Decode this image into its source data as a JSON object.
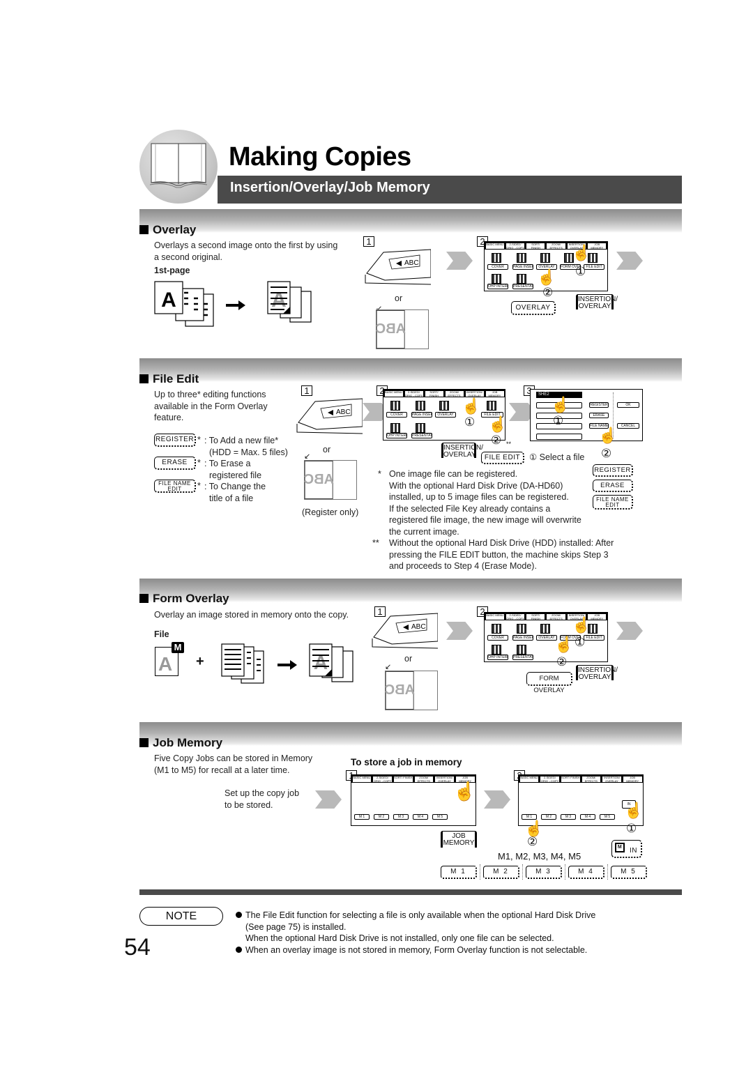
{
  "header": {
    "title": "Making Copies",
    "subtitle": "Insertion/Overlay/Job Memory",
    "icon": "book-icon"
  },
  "common": {
    "or": "or",
    "step_labels": [
      "1",
      "2",
      "3"
    ],
    "circled_1": "①",
    "circled_2": "②",
    "tabs": [
      "BASIC MENU",
      "2-SIDED/ ORIG→COPY",
      "SORT/ FINISH",
      "ZOOM/ EFFECTS",
      "INSERTION/ OVERLAY",
      "JOB MEMORY"
    ],
    "panel_buttons": [
      "COVER",
      "PAGE INSERTION",
      "OVERLAY",
      "FORM OVERLAY",
      "FILE EDIT",
      "OHP INTERLEAVING",
      "PRESENTATION"
    ],
    "glass_text": "ABC",
    "feeder_text": "ABC",
    "insertion_overlay_key": "INSERTION/ OVERLAY"
  },
  "overlay": {
    "title": "Overlay",
    "description_lines": [
      "Overlays a second image onto the first by using",
      "a second original."
    ],
    "sub_label": "1st-page",
    "page_letter": "A",
    "overlay_key": "OVERLAY"
  },
  "file_edit": {
    "title": "File Edit",
    "description_lines": [
      "Up to three* editing functions",
      "available in the Form Overlay",
      "feature."
    ],
    "functions": [
      {
        "key": "REGISTER",
        "mark": "*",
        "lines": [
          ": To Add a new file*",
          "(HDD = Max. 5 files)"
        ]
      },
      {
        "key": "ERASE",
        "mark": "*",
        "lines": [
          ": To Erase a",
          "registered file"
        ]
      },
      {
        "key": "FILE NAME EDIT",
        "mark": "*",
        "lines": [
          ": To Change the",
          "title of a file"
        ]
      }
    ],
    "register_only": "(Register only)",
    "file_edit_key": "FILE EDIT",
    "double_star": "**",
    "select_file": "① Select a file",
    "step3_panel": {
      "selected_file": "SHE2",
      "buttons": [
        "REGISTER",
        "ERASE",
        "FILE NAME EDIT",
        "OK",
        "CANCEL"
      ]
    },
    "side_keys": [
      "REGISTER",
      "ERASE",
      "FILE NAME EDIT"
    ],
    "footnote_1_mark": "*",
    "footnote_1_lines": [
      "One image file can be registered.",
      "With the optional Hard Disk Drive (DA-HD60)",
      "installed, up to 5 image files can be registered.",
      "If the selected File Key already contains a",
      "registered file image, the new image will overwrite",
      "the current image."
    ],
    "footnote_2_mark": "**",
    "footnote_2_lines": [
      "Without the optional Hard Disk Drive (HDD) installed: After",
      "pressing the FILE EDIT button, the machine skips Step 3",
      "and proceeds to Step 4 (Erase Mode)."
    ]
  },
  "form_overlay": {
    "title": "Form Overlay",
    "description": "Overlay an image stored in memory onto the copy.",
    "sub_label": "File",
    "memory_badge": "M",
    "page_letter": "A",
    "plus": "+",
    "form_overlay_key": "FORM OVERLAY"
  },
  "job_memory": {
    "title": "Job Memory",
    "description_lines": [
      "Five Copy Jobs can be stored in Memory",
      "(M1 to M5) for recall at a later time."
    ],
    "procedure_title": "To store a job in memory",
    "setup_lines": [
      "Set up the copy job",
      "to be stored."
    ],
    "job_memory_key": "JOB MEMORY",
    "memory_slots": [
      "M 1",
      "M 2",
      "M 3",
      "M 4",
      "M 5"
    ],
    "slots_caption": "M1, M2, M3, M4, M5",
    "in_key": "IN",
    "in_icon_letter": "M"
  },
  "note": {
    "label": "NOTE",
    "items": [
      {
        "lines": [
          "The File Edit function for selecting a file is only available when the optional Hard Disk Drive",
          "(See page 75) is installed.",
          "When the optional Hard Disk Drive is not installed, only one file can be selected."
        ]
      },
      {
        "lines": [
          "When an overlay image is not stored in memory, Form Overlay function is not selectable."
        ]
      }
    ]
  },
  "page_number": "54"
}
